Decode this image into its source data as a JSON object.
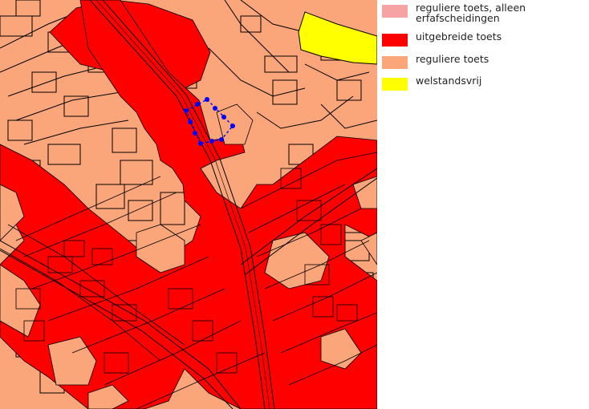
{
  "legend": {
    "items": [
      {
        "label": "reguliere toets, alleen erfafscheidingen",
        "color": "#f7a3a3"
      },
      {
        "label": "uitgebreide toets",
        "color": "#ff0000"
      },
      {
        "label": "reguliere toets",
        "color": "#fba57a"
      },
      {
        "label": "welstandsvrij",
        "color": "#ffff00"
      }
    ]
  },
  "map": {
    "zones": {
      "regular": "#fba57a",
      "extended": "#ff0000",
      "free": "#ffff00"
    },
    "parcel_outline_color": "#000000",
    "selection_color": "#0000ff"
  }
}
